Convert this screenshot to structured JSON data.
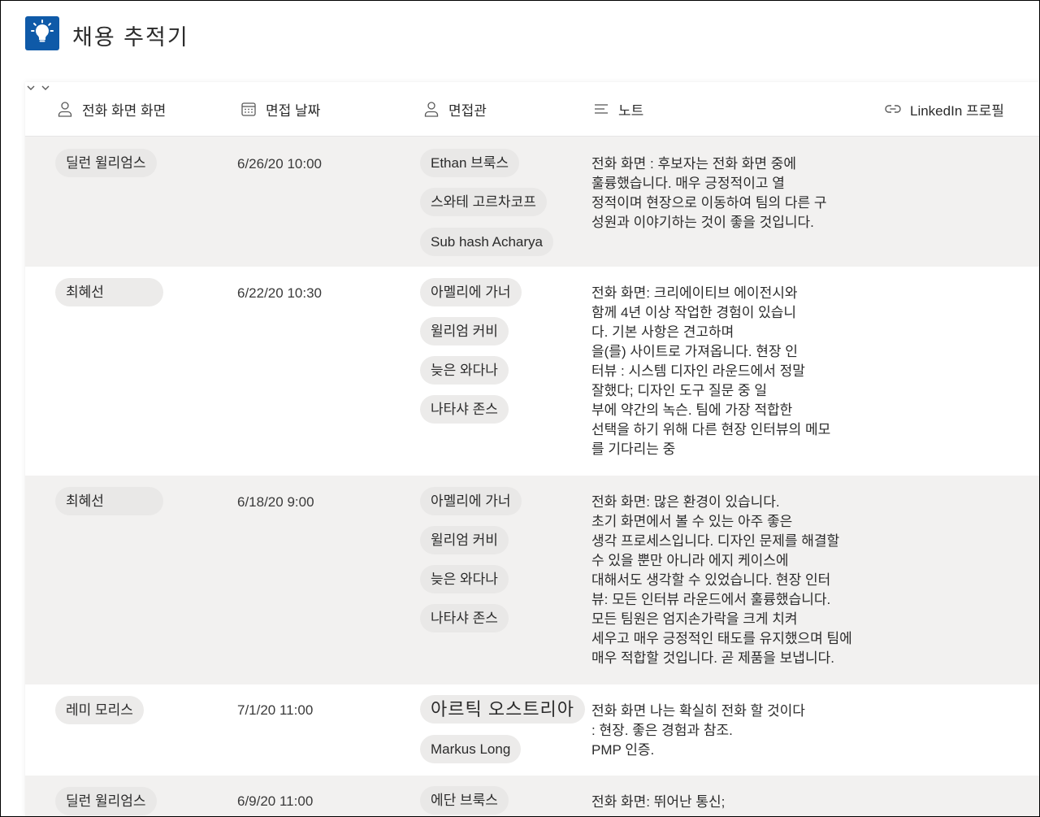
{
  "app": {
    "title": "채용 추적기",
    "icon": "lightbulb-icon",
    "accent": "#0f5aa8"
  },
  "columns": [
    {
      "label": "전화 화면 화면",
      "icon": "person-icon",
      "has_dropdown": false
    },
    {
      "label": "면접 날짜",
      "icon": "calendar-icon",
      "has_dropdown": true
    },
    {
      "label": "면접관",
      "icon": "person-icon",
      "has_dropdown": true
    },
    {
      "label": "노트",
      "icon": "lines-icon",
      "has_dropdown": false
    },
    {
      "label": "LinkedIn 프로필",
      "icon": "link-icon",
      "has_dropdown": false
    }
  ],
  "rows": [
    {
      "candidate": "딜런 윌리엄스",
      "date": "6/26/20 10:00",
      "interviewers": [
        "Ethan 브룩스",
        "스와테 고르차코프",
        "Sub hash Acharya"
      ],
      "note": "전화 화면 : 후보자는 전화 화면 중에\n훌륭했습니다. 매우 긍정적이고 열\n정적이며 현장으로 이동하여 팀의 다른 구\n성원과 이야기하는 것이 좋을 것입니다."
    },
    {
      "candidate": "최혜선",
      "date": "6/22/20 10:30",
      "interviewers": [
        "아멜리에 가너",
        "윌리엄 커비",
        "늦은 와다나",
        "나타샤 존스"
      ],
      "note": "전화 화면: 크리에이티브 에이전시와\n함께 4년 이상 작업한 경험이 있습니\n다.       기본 사항은 견고하며\n을(를) 사이트로 가져옵니다. 현장 인\n터뷰 : 시스템 디자인 라운드에서 정말\n잘했다; 디자인 도구 질문 중 일\n부에 약간의 녹슨. 팀에 가장 적합한\n선택을 하기 위해 다른 현장 인터뷰의 메모\n를 기다리는 중"
    },
    {
      "candidate": "최혜선",
      "date": "6/18/20 9:00",
      "interviewers": [
        "아멜리에 가너",
        "윌리엄 커비",
        "늦은 와다나",
        "나타샤 존스"
      ],
      "note": "전화 화면: 많은 환경이 있습니다.\n초기 화면에서 볼 수 있는 아주 좋은\n생각 프로세스입니다. 디자인 문제를 해결할\n수 있을 뿐만 아니라 에지 케이스에\n대해서도 생각할 수 있었습니다. 현장 인터\n뷰: 모든 인터뷰 라운드에서 훌륭했습니다.\n모든 팀원은 엄지손가락을 크게 치켜\n세우고 매우 긍정적인 태도를 유지했으며 팀에\n매우 적합할 것입니다. 곧 제품을 보냅니다."
    },
    {
      "candidate": "레미 모리스",
      "date": "7/1/20 11:00",
      "interviewers": [
        "아르틱 오스트리아",
        "Markus Long"
      ],
      "note": "전화 화면         나는 확실히 전화 할 것이다\n: 현장. 좋은 경험과 참조.\nPMP 인증."
    },
    {
      "candidate": "딜런 윌리엄스",
      "date": "6/9/20 11:00",
      "interviewers": [
        "에단 브룩스"
      ],
      "note": "전화 화면: 뛰어난 통신;"
    }
  ]
}
